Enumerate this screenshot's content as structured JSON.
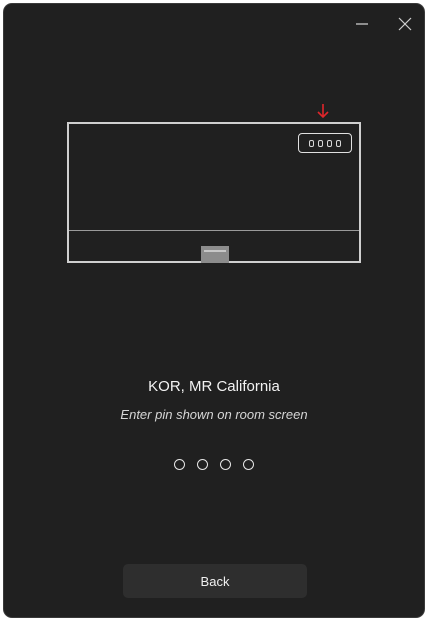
{
  "room": {
    "name": "KOR, MR California",
    "instruction": "Enter pin shown on room screen"
  },
  "pin": {
    "length": 4,
    "entered": 0
  },
  "actions": {
    "back_label": "Back"
  },
  "icons": {
    "minimize": "minimize-icon",
    "close": "close-icon",
    "pointer": "arrow-down-icon"
  },
  "colors": {
    "background": "#202020",
    "pointer_arrow": "#e0262b",
    "button": "#2e2e2e"
  }
}
